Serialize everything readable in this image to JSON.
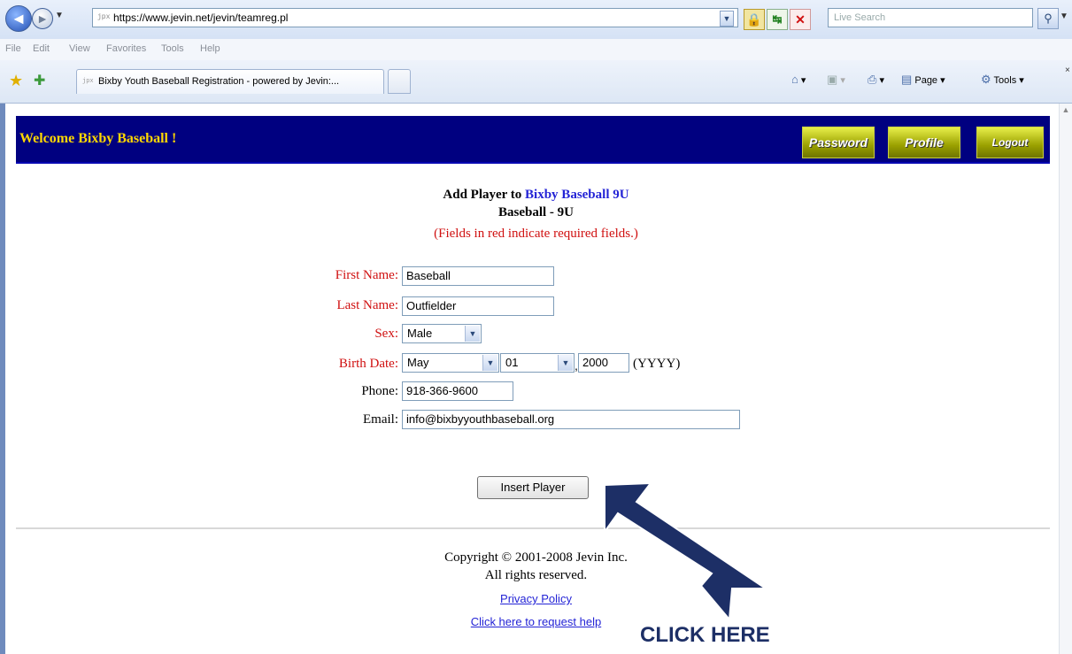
{
  "browser": {
    "url": "https://www.jevin.net/jevin/teamreg.pl",
    "search_placeholder": "Live Search",
    "menu": [
      "File",
      "Edit",
      "View",
      "Favorites",
      "Tools",
      "Help"
    ],
    "tab_title": "Bixby Youth Baseball Registration - powered by Jevin:...",
    "commands": {
      "page": "Page",
      "tools": "Tools"
    }
  },
  "site": {
    "welcome": "Welcome Bixby Baseball !",
    "nav_buttons": [
      "Password",
      "Profile",
      "Logout"
    ]
  },
  "form": {
    "heading_prefix": "Add Player to ",
    "team_name": "Bixby Baseball 9U",
    "subheading": "Baseball - 9U",
    "required_note": "(Fields in red indicate required fields.)",
    "first_name": {
      "label": "First Name:",
      "value": "Baseball"
    },
    "last_name": {
      "label": "Last Name:",
      "value": "Outfielder"
    },
    "sex": {
      "label": "Sex:",
      "value": "Male"
    },
    "birth_date": {
      "label": "Birth Date:",
      "month": "May",
      "day": "01",
      "separator": ",",
      "year": "2000",
      "year_hint": "(YYYY)"
    },
    "phone": {
      "label": "Phone:",
      "value": "918-366-9600"
    },
    "email": {
      "label": "Email:",
      "value": "info@bixbyyouthbaseball.org"
    },
    "submit_label": "Insert Player"
  },
  "footer": {
    "copyright": "Copyright © 2001-2008 Jevin Inc.",
    "rights": "All rights reserved.",
    "privacy_link": "Privacy Policy",
    "help_link": "Click here to request help"
  },
  "annotation": {
    "callout_text": "CLICK HERE",
    "arrow_color": "#1d2f66"
  },
  "colors": {
    "banner": "#000080",
    "welcome_text": "#ffd700",
    "required": "#d01010",
    "link": "#2424d6"
  }
}
